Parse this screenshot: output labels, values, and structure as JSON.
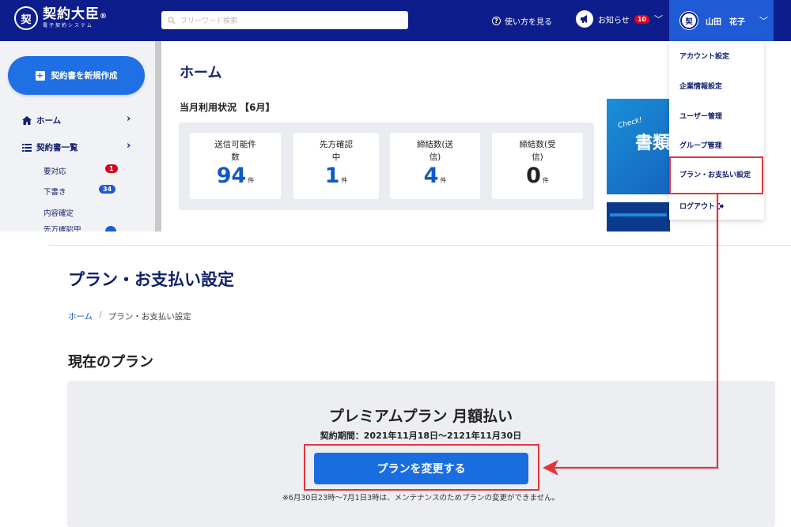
{
  "header": {
    "logo_seal": "契",
    "logo_main": "契約大臣",
    "logo_mark": "®",
    "logo_sub": "電子契約システム",
    "search_placeholder": "フリーワード検索",
    "help_label": "使い方を見る",
    "notice_label": "お知らせ",
    "notice_count": "10",
    "user_avatar": "契",
    "user_name": "山田　花子"
  },
  "sidebar": {
    "new_button": "契約書を新規作成",
    "items": [
      {
        "label": "ホーム",
        "icon": "home-icon"
      },
      {
        "label": "契約書一覧",
        "icon": "list-icon"
      }
    ],
    "sub_items": [
      {
        "label": "要対応",
        "count": "1",
        "badge_color": "#d7001b"
      },
      {
        "label": "下書き",
        "count": "34",
        "badge_color": "#1e5bd4"
      },
      {
        "label": "内容確定",
        "count": ""
      },
      {
        "label": "先方確認中",
        "count": ""
      }
    ]
  },
  "home": {
    "title": "ホーム",
    "usage_title": "当月利用状況 【6月】",
    "cards": [
      {
        "label": "送信可能件\n数",
        "value": "94",
        "unit": "件"
      },
      {
        "label": "先方確認\n中",
        "value": "1",
        "unit": "件"
      },
      {
        "label": "締結数(送\n信)",
        "value": "4",
        "unit": "件"
      },
      {
        "label": "締結数(受\n信)",
        "value": "0",
        "unit": "件"
      }
    ],
    "banner_check": "Check!",
    "banner_text": "書類"
  },
  "dropdown": {
    "items": [
      "アカウント設定",
      "企業情報設定",
      "ユーザー管理",
      "グループ管理",
      "プラン・お支払い設定",
      "ログアウト"
    ]
  },
  "plan_page": {
    "title": "プラン・お支払い設定",
    "breadcrumb_home": "ホーム",
    "breadcrumb_sep": "/",
    "breadcrumb_current": "プラン・お支払い設定",
    "section_title": "現在のプラン",
    "plan_name": "プレミアムプラン 月額払い",
    "plan_period": "契約期間：2021年11月18日〜2121年11月30日",
    "change_button": "プランを変更する",
    "note": "※6月30日23時〜7月1日3時は、メンテナンスのためプランの変更ができません。"
  },
  "colors": {
    "header_bg": "#0d1d8c",
    "accent": "#1a6de0",
    "highlight": "#e4343c"
  }
}
